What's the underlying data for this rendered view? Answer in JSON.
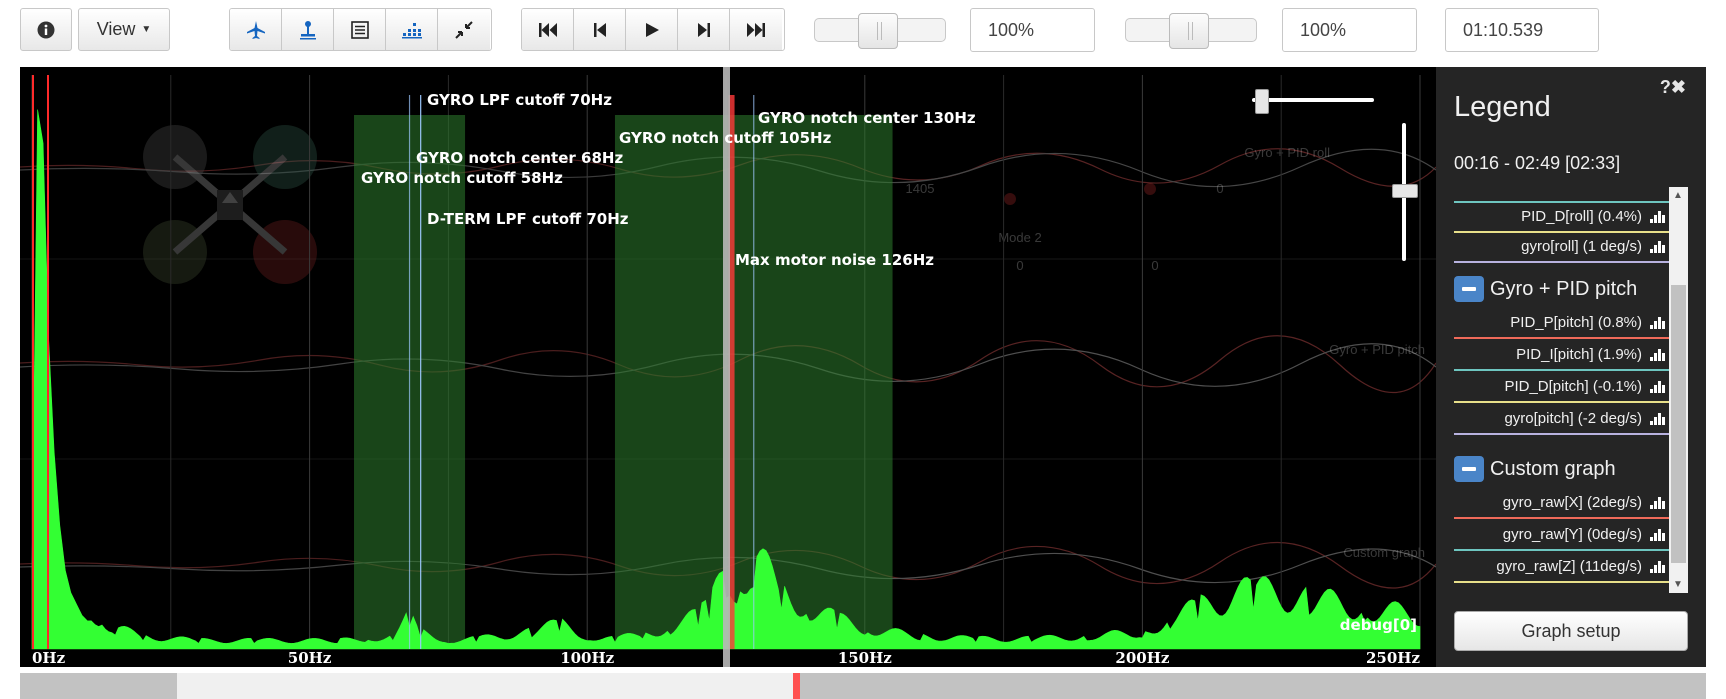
{
  "toolbar": {
    "info_icon": "info-icon",
    "view_label": "View",
    "tools": [
      "craft-icon",
      "sticks-icon",
      "table-icon",
      "analyser-icon",
      "collapse-icon"
    ],
    "playback": [
      "skip-start-icon",
      "step-back-icon",
      "play-icon",
      "step-forward-icon",
      "skip-end-icon"
    ],
    "zoom_value": "100%",
    "speed_value": "100%",
    "time_value": "01:10.539"
  },
  "graph": {
    "filter_labels": {
      "gyro_lpf": "GYRO LPF cutoff 70Hz",
      "gyro_notch_center_2": "GYRO notch center 130Hz",
      "gyro_notch_cutoff_2": "GYRO notch cutoff 105Hz",
      "gyro_notch_center_1": "GYRO notch center 68Hz",
      "gyro_notch_cutoff_1": "GYRO notch cutoff 58Hz",
      "dterm_lpf": "D-TERM LPF cutoff 70Hz",
      "max_motor_noise": "Max motor noise 126Hz"
    },
    "debug_label": "debug[0]",
    "ghost_labels": {
      "roll": "Gyro + PID roll",
      "pitch": "Gyro + PID pitch",
      "custom": "Custom graph",
      "rc_value": "1405",
      "zero_a": "0",
      "zero_b": "0",
      "zero_c": "0",
      "mode": "Mode 2"
    }
  },
  "chart_data": {
    "type": "area",
    "title": "",
    "xlabel": "",
    "ylabel": "",
    "x_ticks": [
      "0Hz",
      "50Hz",
      "100Hz",
      "150Hz",
      "200Hz",
      "250Hz"
    ],
    "xlim": [
      0,
      250
    ],
    "series": [
      {
        "name": "debug[0]",
        "x": [
          0,
          1,
          2,
          3,
          4,
          5,
          6,
          7,
          8,
          9,
          10,
          12,
          15,
          20,
          30,
          40,
          55,
          60,
          65,
          68,
          70,
          75,
          80,
          90,
          95,
          100,
          105,
          110,
          115,
          120,
          122,
          125,
          127,
          130,
          135,
          140,
          145,
          150,
          160,
          170,
          180,
          190,
          200,
          205,
          210,
          220,
          230,
          240,
          250
        ],
        "values": [
          0.15,
          0.96,
          0.9,
          0.55,
          0.35,
          0.22,
          0.14,
          0.1,
          0.08,
          0.06,
          0.05,
          0.04,
          0.025,
          0.015,
          0.01,
          0.01,
          0.01,
          0.012,
          0.015,
          0.04,
          0.02,
          0.01,
          0.012,
          0.02,
          0.03,
          0.015,
          0.012,
          0.018,
          0.025,
          0.04,
          0.05,
          0.09,
          0.08,
          0.11,
          0.07,
          0.05,
          0.035,
          0.025,
          0.015,
          0.012,
          0.012,
          0.015,
          0.02,
          0.035,
          0.05,
          0.07,
          0.06,
          0.05,
          0.04
        ]
      }
    ],
    "bands": [
      {
        "from": 58,
        "to": 78,
        "label": "GYRO notch cutoff 58Hz"
      },
      {
        "from": 105,
        "to": 155,
        "label": "GYRO notch cutoff 105Hz"
      }
    ],
    "markers": [
      {
        "x": 68,
        "label": "GYRO notch center 68Hz"
      },
      {
        "x": 70,
        "label": "GYRO LPF cutoff 70Hz"
      },
      {
        "x": 70,
        "label": "D-TERM LPF cutoff 70Hz"
      },
      {
        "x": 130,
        "label": "GYRO notch center 130Hz"
      },
      {
        "x": 126,
        "label": "Max motor noise 126Hz"
      }
    ]
  },
  "legend": {
    "title": "Legend",
    "icons": "?✖",
    "range": "00:16 - 02:49 [02:33]",
    "groups": [
      {
        "title": "",
        "items": [
          {
            "label": "PID_D[roll] (0.4%)",
            "color": "#6ec6c0"
          },
          {
            "label": "gyro[roll] (1 deg/s)",
            "color": "#e8e08a"
          }
        ]
      },
      {
        "title": "Gyro + PID pitch",
        "items": [
          {
            "label": "PID_P[pitch] (0.8%)",
            "color": "#f06a5a"
          },
          {
            "label": "PID_I[pitch] (1.9%)",
            "color": "#6ec6c0"
          },
          {
            "label": "PID_D[pitch] (-0.1%)",
            "color": "#e8e08a"
          },
          {
            "label": "gyro[pitch] (-2 deg/s)",
            "color": "#b8b2e0"
          }
        ]
      },
      {
        "title": "Custom graph",
        "items": [
          {
            "label": "gyro_raw[X] (2deg/s)",
            "color": "#f06a5a"
          },
          {
            "label": "gyro_raw[Y] (0deg/s)",
            "color": "#6ec6c0"
          },
          {
            "label": "gyro_raw[Z] (11deg/s)",
            "color": "#e8e08a"
          }
        ]
      }
    ],
    "setup_label": "Graph setup"
  },
  "timeline": {
    "marker_color": "#ff5050"
  },
  "colors": {
    "spectrum": "#33ff33",
    "band": "#2e7d2e",
    "accent": "#1565c0"
  }
}
